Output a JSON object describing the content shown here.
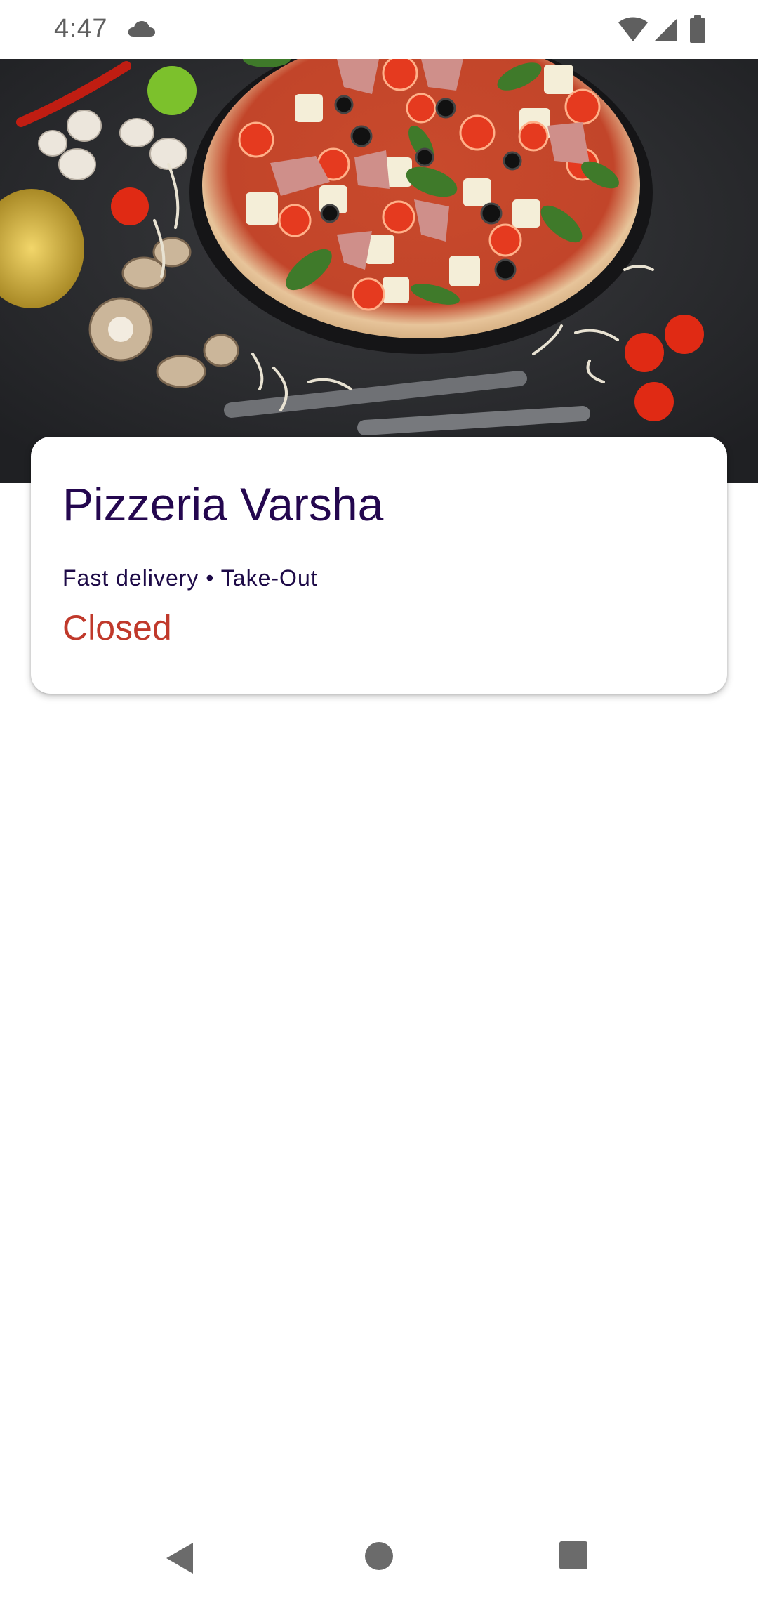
{
  "status_bar": {
    "time": "4:47",
    "icons": [
      "cloud-icon",
      "wifi-icon",
      "cellular-signal-icon",
      "battery-icon"
    ]
  },
  "hero": {
    "image_subject": "pizza-photo"
  },
  "restaurant": {
    "name": "Pizzeria Varsha",
    "tags": "Fast delivery • Take-Out",
    "status": "Closed"
  },
  "colors": {
    "title": "#24074f",
    "status_closed": "#c0392b",
    "background": "#ffffff"
  },
  "nav_bar": {
    "icons": [
      "back-icon",
      "home-icon",
      "recents-icon"
    ]
  }
}
